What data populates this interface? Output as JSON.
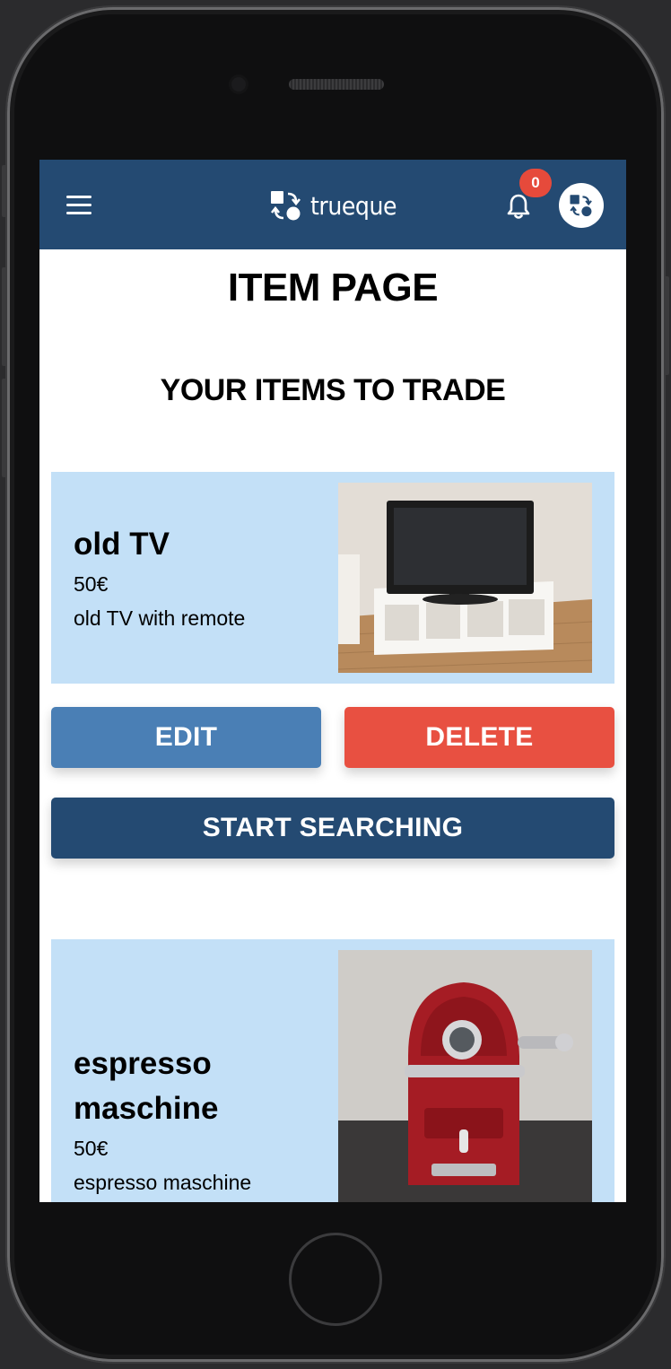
{
  "app": {
    "logo_text": "trueque",
    "notification_count": "0"
  },
  "page": {
    "title": "ITEM PAGE",
    "section_title": "YOUR ITEMS TO TRADE"
  },
  "items": [
    {
      "name": "old TV",
      "price": "50€",
      "description": "old TV with remote"
    },
    {
      "name": "espresso maschine",
      "price": "50€",
      "description": "espresso maschine"
    }
  ],
  "actions": {
    "edit_label": "EDIT",
    "delete_label": "DELETE",
    "search_label": "START SEARCHING"
  },
  "icons": {
    "menu": "hamburger-menu-icon",
    "notifications": "bell-icon",
    "profile": "trueque-logo-icon"
  },
  "colors": {
    "navbar": "#244a72",
    "card_bg": "#c3e0f7",
    "edit": "#4a7fb5",
    "delete": "#e85041",
    "search": "#244a72",
    "badge": "#e64a3b"
  }
}
